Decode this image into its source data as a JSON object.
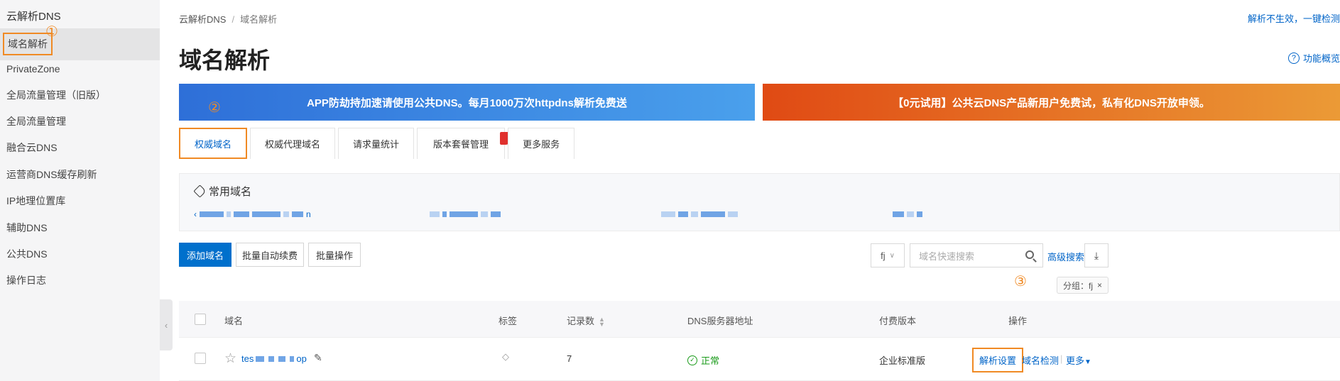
{
  "sidebar": {
    "title": "云解析DNS",
    "items": [
      {
        "label": "域名解析"
      },
      {
        "label": "PrivateZone"
      },
      {
        "label": "全局流量管理（旧版）"
      },
      {
        "label": "全局流量管理"
      },
      {
        "label": "融合云DNS"
      },
      {
        "label": "运营商DNS缓存刷新"
      },
      {
        "label": "IP地理位置库"
      },
      {
        "label": "辅助DNS"
      },
      {
        "label": "公共DNS"
      },
      {
        "label": "操作日志"
      }
    ],
    "collapse_glyph": "‹"
  },
  "steps": {
    "one": "①",
    "two": "②",
    "three": "③"
  },
  "breadcrumb": {
    "root": "云解析DNS",
    "sep": "/",
    "current": "域名解析"
  },
  "top_link": "解析不生效，一键检测",
  "page_title": "域名解析",
  "overview_link": "功能概览",
  "banners": {
    "left": "APP防劫持加速请使用公共DNS。每月1000万次httpdns解析免费送",
    "right": "【0元试用】公共云DNS产品新用户免费试，私有化DNS开放申领。"
  },
  "tabs": [
    {
      "label": "权威域名"
    },
    {
      "label": "权威代理域名"
    },
    {
      "label": "请求量统计"
    },
    {
      "label": "版本套餐管理"
    },
    {
      "label": "更多服务"
    }
  ],
  "favorites": {
    "title": "常用域名",
    "item1_prefix": "‹",
    "item1_suffix": "n"
  },
  "actions": {
    "add": "添加域名",
    "renew": "批量自动续费",
    "batch": "批量操作"
  },
  "filter": {
    "select_value": "fj",
    "search_placeholder": "域名快速搜索",
    "advanced": "高级搜索",
    "group_tag": "分组：fj",
    "group_close": "×"
  },
  "table": {
    "headers": {
      "domain": "域名",
      "tag": "标签",
      "records": "记录数",
      "dns": "DNS服务器地址",
      "edition": "付费版本",
      "ops": "操作"
    },
    "rows": [
      {
        "domain_prefix": "tes",
        "domain_suffix": "op",
        "records": "7",
        "dns_status": "正常",
        "edition": "企业标准版",
        "op_settings": "解析设置",
        "op_check": "域名检测",
        "op_more": "更多"
      }
    ]
  },
  "colors": {
    "accent": "#0064c8",
    "highlight": "#f08a24",
    "ok": "#1a9b1a"
  }
}
